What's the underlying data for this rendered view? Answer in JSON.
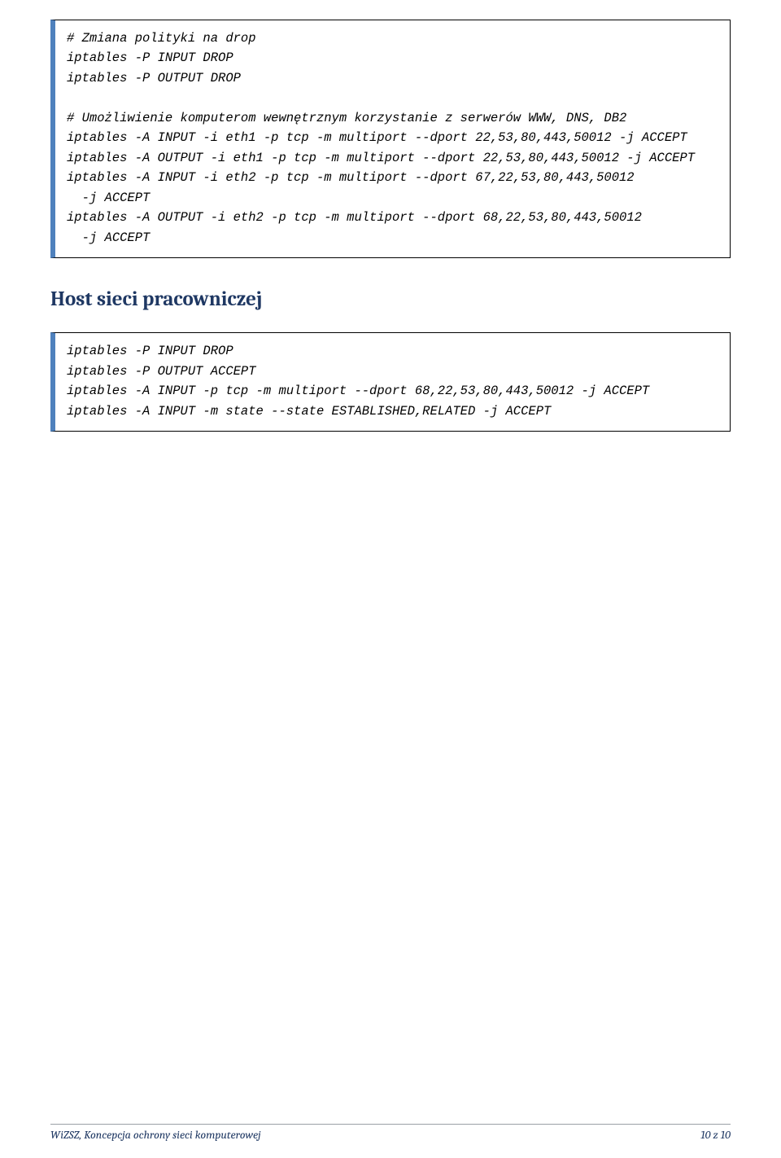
{
  "code_block_1": "# Zmiana polityki na drop\niptables -P INPUT DROP\niptables -P OUTPUT DROP\n\n# Umożliwienie komputerom wewnętrznym korzystanie z serwerów WWW, DNS, DB2\niptables -A INPUT -i eth1 -p tcp -m multiport --dport 22,53,80,443,50012 -j ACCEPT\niptables -A OUTPUT -i eth1 -p tcp -m multiport --dport 22,53,80,443,50012 -j ACCEPT\niptables -A INPUT -i eth2 -p tcp -m multiport --dport 67,22,53,80,443,50012\n  -j ACCEPT\niptables -A OUTPUT -i eth2 -p tcp -m multiport --dport 68,22,53,80,443,50012\n  -j ACCEPT",
  "heading": "Host sieci pracowniczej",
  "code_block_2": "iptables -P INPUT DROP\niptables -P OUTPUT ACCEPT\niptables -A INPUT -p tcp -m multiport --dport 68,22,53,80,443,50012 -j ACCEPT\niptables -A INPUT -m state --state ESTABLISHED,RELATED -j ACCEPT",
  "footer_left": "WiZSZ, Koncepcja ochrony sieci komputerowej",
  "footer_right": "10 z 10"
}
